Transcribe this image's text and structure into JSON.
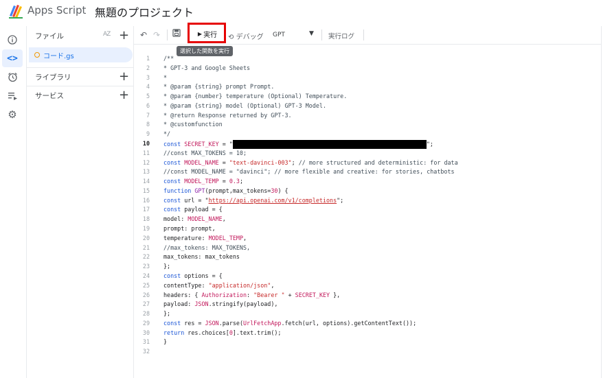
{
  "header": {
    "app_name": "Apps Script",
    "project_title": "無題のプロジェクト"
  },
  "rail": {
    "items": [
      {
        "name": "overview",
        "icon": "info-icon"
      },
      {
        "name": "editor",
        "icon": "code-icon",
        "active": true
      },
      {
        "name": "triggers",
        "icon": "alarm-clock-icon"
      },
      {
        "name": "executions",
        "icon": "list-play-icon"
      },
      {
        "name": "settings",
        "icon": "gear-icon"
      }
    ]
  },
  "sidebar": {
    "files_label": "ファイル",
    "sort_label": "AZ",
    "file_name": "コード.gs",
    "libraries_label": "ライブラリ",
    "services_label": "サービス"
  },
  "toolbar": {
    "run_label": "実行",
    "debug_label": "デバッグ",
    "function_selected": "GPT",
    "exec_log_label": "実行ログ",
    "highlight_color": "#e60000"
  },
  "tooltip": "選択した関数を実行",
  "editor": {
    "current_line": 10,
    "lines": [
      {
        "n": "1",
        "segs": [
          [
            "comment",
            "/**"
          ]
        ]
      },
      {
        "n": "2",
        "segs": [
          [
            "comment",
            "* GPT-3 and Google Sheets"
          ]
        ]
      },
      {
        "n": "3",
        "segs": [
          [
            "comment",
            "*"
          ]
        ]
      },
      {
        "n": "4",
        "segs": [
          [
            "comment",
            "* @param {string} prompt Prompt."
          ]
        ]
      },
      {
        "n": "5",
        "segs": [
          [
            "comment",
            "* @param {number} temperature (Optional) Temperature."
          ]
        ]
      },
      {
        "n": "6",
        "segs": [
          [
            "comment",
            "* @param {string} model (Optional) GPT-3 Model."
          ]
        ]
      },
      {
        "n": "7",
        "segs": [
          [
            "comment",
            "* @return Response returned by GPT-3."
          ]
        ]
      },
      {
        "n": "8",
        "segs": [
          [
            "comment",
            "* @customfunction"
          ]
        ]
      },
      {
        "n": "9",
        "segs": [
          [
            "comment",
            "*/"
          ]
        ]
      },
      {
        "n": "10",
        "segs": [
          [
            "kw",
            "const "
          ],
          [
            "var",
            "SECRET_KEY"
          ],
          [
            "",
            " = \""
          ],
          [
            "redact",
            ""
          ],
          [
            "",
            "\";"
          ]
        ]
      },
      {
        "n": "11",
        "segs": [
          [
            "comment",
            "//const MAX_TOKENS = 10;"
          ]
        ]
      },
      {
        "n": "12",
        "segs": [
          [
            "kw",
            "const "
          ],
          [
            "var",
            "MODEL_NAME"
          ],
          [
            "",
            " = "
          ],
          [
            "str",
            "\"text-davinci-003\""
          ],
          [
            "",
            "; "
          ],
          [
            "comment",
            "// more structured and deterministic: for data"
          ]
        ]
      },
      {
        "n": "13",
        "segs": [
          [
            "comment",
            "//const MODEL_NAME = \"davinci\"; // more flexible and creative: for stories, chatbots"
          ]
        ]
      },
      {
        "n": "14",
        "segs": [
          [
            "kw",
            "const "
          ],
          [
            "var",
            "MODEL_TEMP"
          ],
          [
            "",
            " = "
          ],
          [
            "var",
            "0.3"
          ],
          [
            "",
            ";"
          ]
        ]
      },
      {
        "n": "15",
        "segs": [
          [
            "kw",
            "function "
          ],
          [
            "fn",
            "GPT"
          ],
          [
            "",
            "(prompt,max_tokens="
          ],
          [
            "var",
            "30"
          ],
          [
            "",
            ") {"
          ]
        ]
      },
      {
        "n": "16",
        "segs": [
          [
            "kw",
            "const "
          ],
          [
            "",
            "url = \""
          ],
          [
            "url",
            "https://api.openai.com/v1/completions"
          ],
          [
            "",
            "\";"
          ]
        ]
      },
      {
        "n": "17",
        "segs": [
          [
            "kw",
            "const "
          ],
          [
            "",
            "payload = {"
          ]
        ]
      },
      {
        "n": "18",
        "segs": [
          [
            "",
            "model: "
          ],
          [
            "var",
            "MODEL_NAME"
          ],
          [
            "",
            ","
          ]
        ]
      },
      {
        "n": "19",
        "segs": [
          [
            "",
            "prompt: prompt,"
          ]
        ]
      },
      {
        "n": "20",
        "segs": [
          [
            "",
            "temperature: "
          ],
          [
            "var",
            "MODEL_TEMP"
          ],
          [
            "",
            ","
          ]
        ]
      },
      {
        "n": "21",
        "segs": [
          [
            "comment",
            "//max_tokens: MAX_TOKENS,"
          ]
        ]
      },
      {
        "n": "22",
        "segs": [
          [
            "",
            "max_tokens: max_tokens"
          ]
        ]
      },
      {
        "n": "23",
        "segs": [
          [
            "",
            "};"
          ]
        ]
      },
      {
        "n": "24",
        "segs": [
          [
            "kw",
            "const "
          ],
          [
            "",
            "options = {"
          ]
        ]
      },
      {
        "n": "25",
        "segs": [
          [
            "",
            "contentType: "
          ],
          [
            "str",
            "\"application/json\""
          ],
          [
            "",
            ","
          ]
        ]
      },
      {
        "n": "26",
        "segs": [
          [
            "",
            "headers: { "
          ],
          [
            "var",
            "Authorization"
          ],
          [
            "",
            ": "
          ],
          [
            "str",
            "\"Bearer \""
          ],
          [
            "",
            " + "
          ],
          [
            "var",
            "SECRET_KEY"
          ],
          [
            "",
            " },"
          ]
        ]
      },
      {
        "n": "27",
        "segs": [
          [
            "",
            "payload: "
          ],
          [
            "var",
            "JSON"
          ],
          [
            "",
            ".stringify(payload),"
          ]
        ]
      },
      {
        "n": "28",
        "segs": [
          [
            "",
            "};"
          ]
        ]
      },
      {
        "n": "29",
        "segs": [
          [
            "kw",
            "const "
          ],
          [
            "",
            "res = "
          ],
          [
            "var",
            "JSON"
          ],
          [
            "",
            ".parse("
          ],
          [
            "var",
            "UrlFetchApp"
          ],
          [
            "",
            ".fetch(url, options).getContentText());"
          ]
        ]
      },
      {
        "n": "30",
        "segs": [
          [
            "kw",
            "return "
          ],
          [
            "",
            "res.choices["
          ],
          [
            "var",
            "0"
          ],
          [
            "",
            "].text.trim();"
          ]
        ]
      },
      {
        "n": "31",
        "segs": [
          [
            "",
            "}"
          ]
        ]
      },
      {
        "n": "32",
        "segs": []
      }
    ]
  }
}
